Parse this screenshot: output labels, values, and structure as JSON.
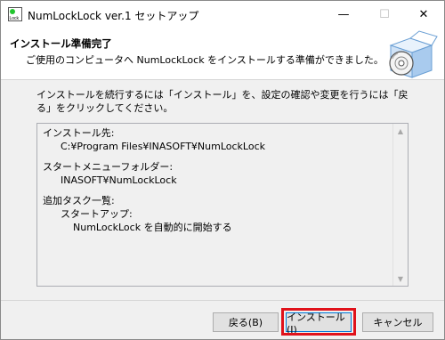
{
  "window": {
    "title": "NumLockLock ver.1 セットアップ",
    "minimize_glyph": "—",
    "maximize_glyph": "☐",
    "close_glyph": "✕",
    "icon": "numlock-app-icon",
    "icon_text": "Lock"
  },
  "header": {
    "title": "インストール準備完了",
    "subtitle": "ご使用のコンピュータへ NumLockLock をインストールする準備ができました。",
    "image": "setup-box-icon"
  },
  "instruction": "インストールを続行するには「インストール」を、設定の確認や変更を行うには「戻る」をクリックしてください。",
  "summary": {
    "dest_label": "インストール先:",
    "dest_value": "C:¥Program Files¥INASOFT¥NumLockLock",
    "startmenu_label": "スタートメニューフォルダー:",
    "startmenu_value": "INASOFT¥NumLockLock",
    "tasks_label": "追加タスク一覧:",
    "startup_label": "スタートアップ:",
    "startup_value": "NumLockLock を自動的に開始する"
  },
  "buttons": {
    "back": "戻る(B)",
    "install": "インストール(I)",
    "cancel": "キャンセル"
  },
  "colors": {
    "highlight": "#e0121b",
    "focus_border": "#0078d7"
  }
}
